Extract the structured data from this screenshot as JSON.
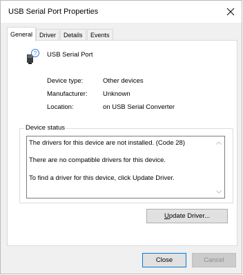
{
  "window": {
    "title": "USB Serial Port Properties"
  },
  "tabs": [
    {
      "label": "General"
    },
    {
      "label": "Driver"
    },
    {
      "label": "Details"
    },
    {
      "label": "Events"
    }
  ],
  "device": {
    "name": "USB Serial Port",
    "icon": "unknown-device-icon"
  },
  "properties": {
    "type_label": "Device type:",
    "type_value": "Other devices",
    "manufacturer_label": "Manufacturer:",
    "manufacturer_value": "Unknown",
    "location_label": "Location:",
    "location_value": "on USB Serial Converter"
  },
  "status": {
    "group_title": "Device status",
    "line1": "The drivers for this device are not installed. (Code 28)",
    "line2": "There are no compatible drivers for this device.",
    "line3": "To find a driver for this device, click Update Driver."
  },
  "buttons": {
    "update_driver_rest": "pdate Driver...",
    "update_driver_mnemonic": "U",
    "close": "Close",
    "cancel": "Cancel"
  },
  "colors": {
    "accent": "#0078d7",
    "dialog_bg": "#f0f0f0"
  }
}
